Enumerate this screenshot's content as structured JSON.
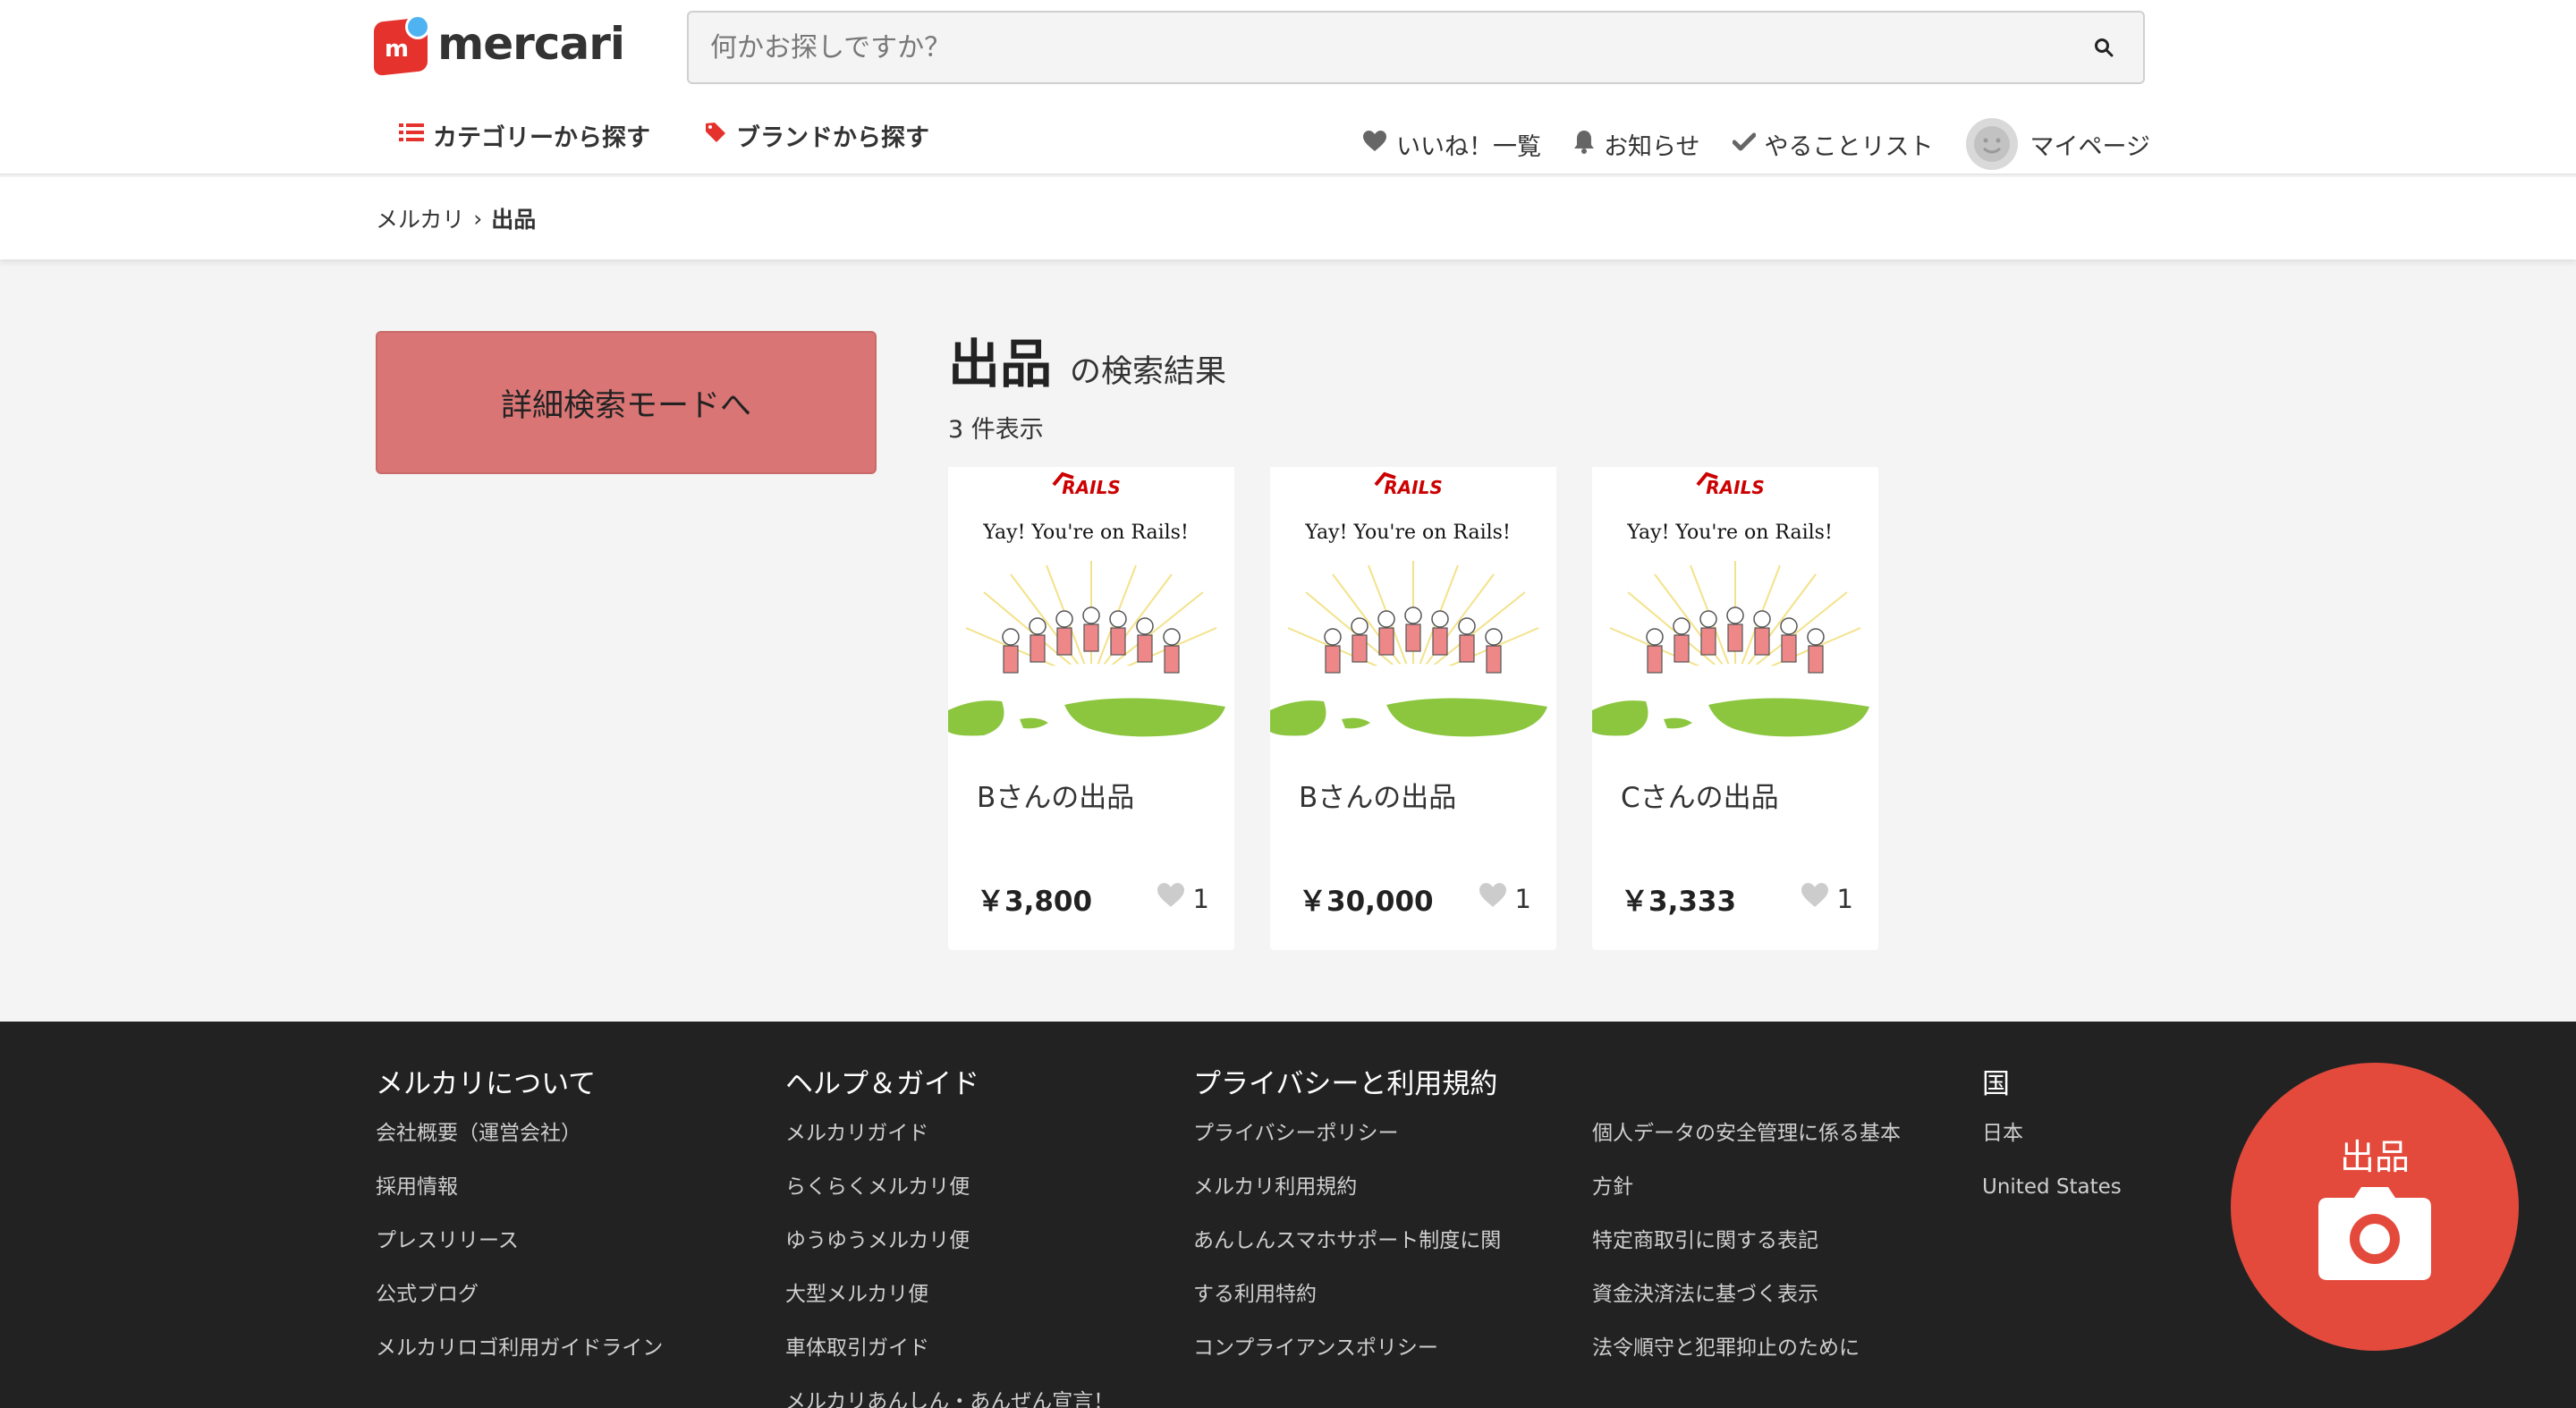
{
  "brand": {
    "logo_text": "mercari",
    "accent": "#e5322d"
  },
  "search": {
    "placeholder": "何かお探しですか？"
  },
  "nav": {
    "category_label": "カテゴリーから探す",
    "brand_label": "ブランドから探す",
    "likes_label": "いいね！一覧",
    "notifications_label": "お知らせ",
    "todo_label": "やることリスト",
    "mypage_label": "マイページ"
  },
  "breadcrumb": {
    "home": "メルカリ",
    "separator": "›",
    "current": "出品"
  },
  "sidebar": {
    "detail_search_label": "詳細検索モードへ"
  },
  "results": {
    "keyword": "出品",
    "suffix": "の検索結果",
    "count_label": "3 件表示"
  },
  "items": [
    {
      "name": "Bさんの出品",
      "price": "￥3,800",
      "likes": "1",
      "image_title": "Yay! You're on Rails!",
      "image_logo": "RAILS"
    },
    {
      "name": "Bさんの出品",
      "price": "￥30,000",
      "likes": "1",
      "image_title": "Yay! You're on Rails!",
      "image_logo": "RAILS"
    },
    {
      "name": "Cさんの出品",
      "price": "￥3,333",
      "likes": "1",
      "image_title": "Yay! You're on Rails!",
      "image_logo": "RAILS"
    }
  ],
  "footer": {
    "about": {
      "title": "メルカリについて",
      "links": [
        "会社概要（運営会社）",
        "採用情報",
        "プレスリリース",
        "公式ブログ",
        "メルカリロゴ利用ガイドライン"
      ]
    },
    "help": {
      "title": "ヘルプ＆ガイド",
      "links": [
        "メルカリガイド",
        "らくらくメルカリ便",
        "ゆうゆうメルカリ便",
        "大型メルカリ便",
        "車体取引ガイド",
        "メルカリあんしん・あんぜん宣言！"
      ]
    },
    "privacy": {
      "title": "プライバシーと利用規約",
      "links": [
        "プライバシーポリシー",
        "メルカリ利用規約",
        "あんしんスマホサポート制度に関",
        "する利用特約",
        "コンプライアンスポリシー"
      ]
    },
    "privacy2": {
      "links": [
        "個人データの安全管理に係る基本",
        "方針",
        "特定商取引に関する表記",
        "資金決済法に基づく表示",
        "法令順守と犯罪抑止のために"
      ]
    },
    "country": {
      "title": "国",
      "links": [
        "日本",
        "United States"
      ]
    }
  },
  "sell_button": {
    "label": "出品",
    "color": "#e34a3c"
  }
}
